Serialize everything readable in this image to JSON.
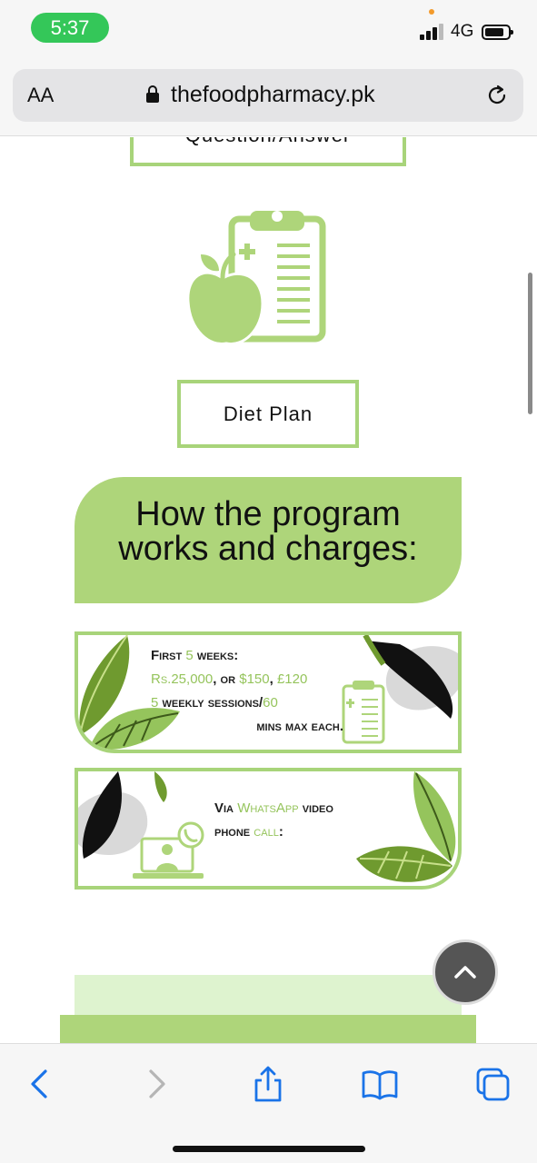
{
  "status": {
    "time": "5:37",
    "network": "4G"
  },
  "browser": {
    "text_size_label": "AA",
    "url": "thefoodpharmacy.pk"
  },
  "content": {
    "qa_button": "Question/Answer",
    "diet_button": "Diet Plan",
    "heading_line1": "How the program",
    "heading_line2": "works and charges:",
    "card1": {
      "line1_a": "First ",
      "line1_b": "5",
      "line1_c": " weeks:",
      "line2_a": "Rs.25,000",
      "line2_b": ", or ",
      "line2_c": "$150",
      "line2_d": ", ",
      "line2_e": "£120",
      "line3_a": "5",
      "line3_b": " weekly sessions/",
      "line3_c": "60",
      "line4": "mins max each."
    },
    "card2": {
      "line1_a": "Via ",
      "line1_b": "WhatsApp",
      "line1_c": " video",
      "line2_a": "phone ",
      "line2_b": "call",
      "line2_c": ":"
    }
  },
  "colors": {
    "accent": "#aed57a",
    "border": "#a8d47a",
    "highlight": "#95c45c",
    "status_pill": "#34c759"
  }
}
